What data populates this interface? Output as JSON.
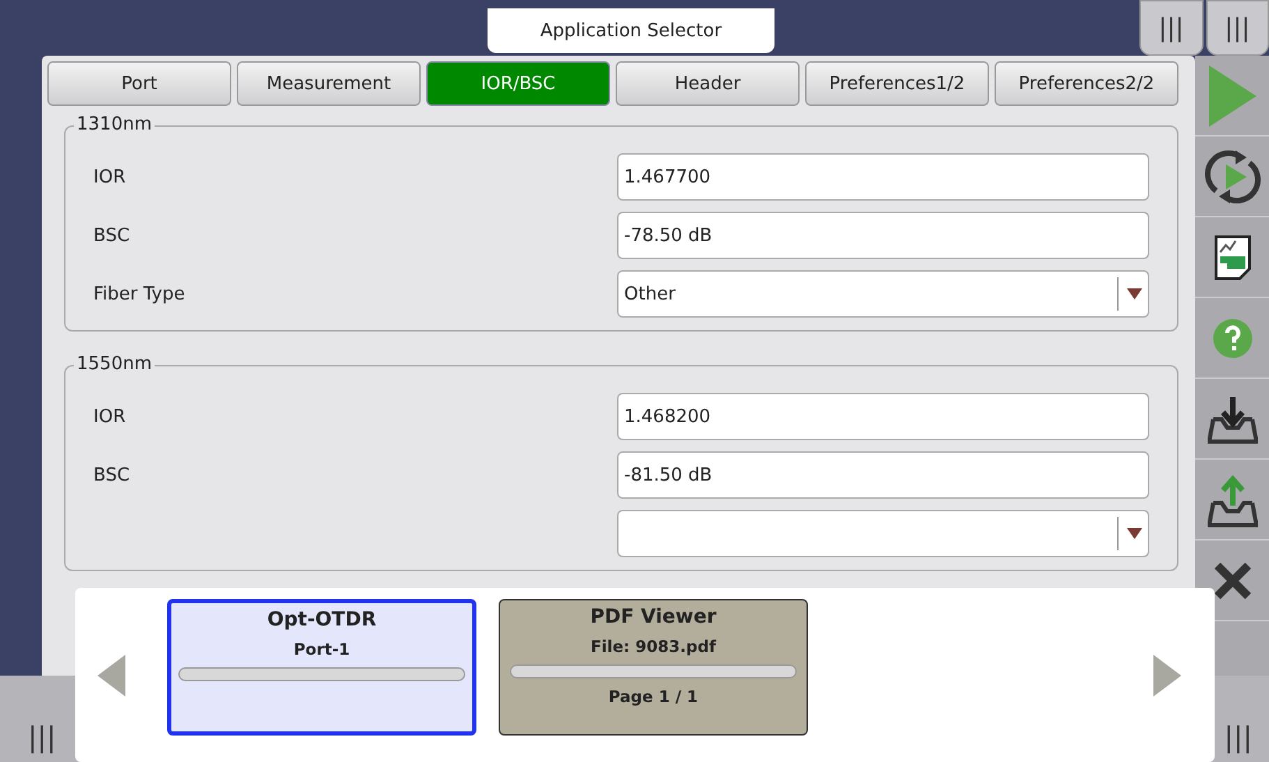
{
  "title_tab": "Application Selector",
  "handles": [
    "|||",
    "|||"
  ],
  "tabs": [
    {
      "label": "Port",
      "selected": false
    },
    {
      "label": "Measurement",
      "selected": false
    },
    {
      "label": "IOR/BSC",
      "selected": true
    },
    {
      "label": "Header",
      "selected": false
    },
    {
      "label": "Preferences1/2",
      "selected": false
    },
    {
      "label": "Preferences2/2",
      "selected": false
    }
  ],
  "groups": [
    {
      "legend": "1310nm",
      "rows": [
        {
          "kind": "input",
          "label": "IOR",
          "value": "1.467700"
        },
        {
          "kind": "input",
          "label": "BSC",
          "value": "-78.50 dB"
        },
        {
          "kind": "select",
          "label": "Fiber Type",
          "value": "Other"
        }
      ]
    },
    {
      "legend": "1550nm",
      "rows": [
        {
          "kind": "input",
          "label": "IOR",
          "value": "1.468200"
        },
        {
          "kind": "input",
          "label": "BSC",
          "value": "-81.50 dB"
        },
        {
          "kind": "select"
        }
      ]
    }
  ],
  "bottom_handles": [
    "|||",
    "|||"
  ],
  "switcher": {
    "apps": [
      {
        "name": "Opt-OTDR",
        "line_1": "Port-1",
        "selected": true
      },
      {
        "name": "PDF Viewer",
        "line_1": "File: 9083.pdf",
        "line_2": "Page 1 / 1",
        "selected": false
      }
    ]
  }
}
